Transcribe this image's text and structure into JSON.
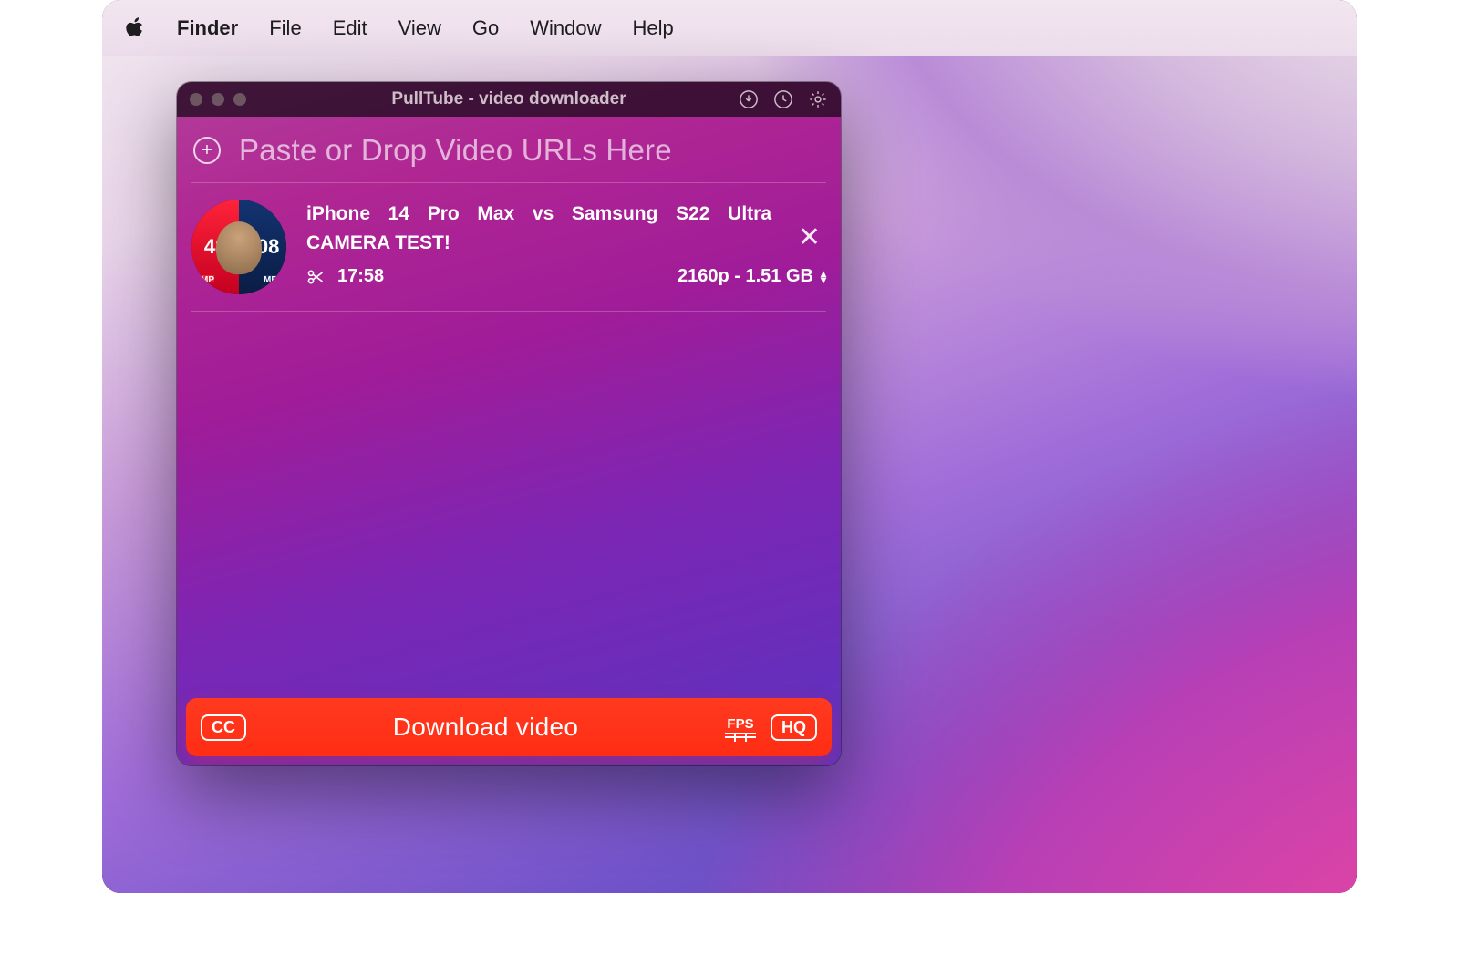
{
  "menubar": {
    "app": "Finder",
    "items": [
      "File",
      "Edit",
      "View",
      "Go",
      "Window",
      "Help"
    ]
  },
  "window": {
    "title": "PullTube - video downloader",
    "url_placeholder": "Paste or Drop Video URLs Here"
  },
  "video": {
    "title": "iPhone 14 Pro Max vs Samsung S22 Ultra CAMERA TEST!",
    "duration": "17:58",
    "quality": "2160p - 1.51 GB",
    "thumb": {
      "left_num": "48",
      "right_num": "108",
      "mp": "MP"
    }
  },
  "bottombar": {
    "cc": "CC",
    "label": "Download video",
    "fps": "FPS",
    "hq": "HQ"
  }
}
